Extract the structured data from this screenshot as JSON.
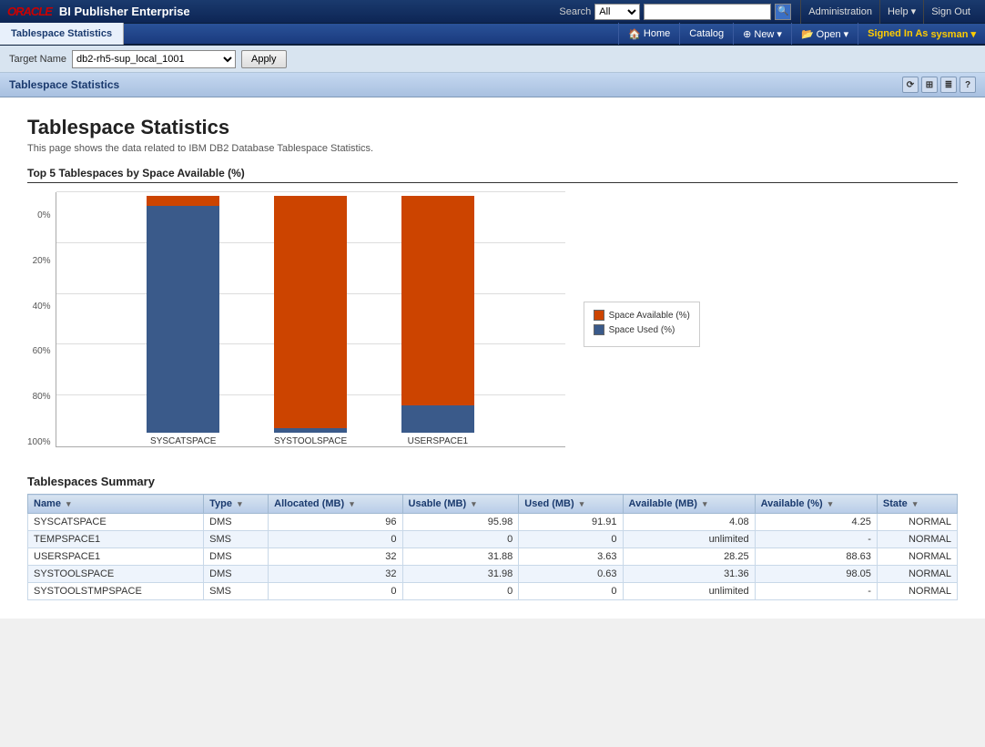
{
  "topNav": {
    "oracleLogo": "ORACLE",
    "appTitle": "BI Publisher Enterprise",
    "searchLabel": "Search",
    "searchScope": "All",
    "searchPlaceholder": "",
    "links": [
      {
        "label": "Administration",
        "name": "admin-link"
      },
      {
        "label": "Help ▾",
        "name": "help-link"
      },
      {
        "label": "Sign Out",
        "name": "signout-link"
      }
    ]
  },
  "secondNav": {
    "pageTab": "Tablespace Statistics",
    "navItems": [
      {
        "label": "Home",
        "name": "home-nav"
      },
      {
        "label": "Catalog",
        "name": "catalog-nav"
      },
      {
        "label": "⊕ New ▾",
        "name": "new-nav"
      },
      {
        "label": "📂 Open ▾",
        "name": "open-nav"
      },
      {
        "label": "Signed In As",
        "name": "signedin-label"
      },
      {
        "label": "sysman ▾",
        "name": "user-nav"
      }
    ]
  },
  "targetBar": {
    "label": "Target Name",
    "selectValue": "db2-rh5-sup_local_1001",
    "applyLabel": "Apply"
  },
  "contentHeader": {
    "title": "Tablespace Statistics",
    "icons": [
      "⟳",
      "⊞",
      "≣",
      "?"
    ]
  },
  "report": {
    "title": "Tablespace Statistics",
    "subtitle": "This page shows the data related to IBM DB2 Database Tablespace Statistics.",
    "chartSectionTitle": "Top 5 Tablespaces by Space Available (%)",
    "tableSectionTitle": "Tablespaces Summary"
  },
  "chart": {
    "yLabels": [
      "0%",
      "20%",
      "40%",
      "60%",
      "80%",
      "100%"
    ],
    "bars": [
      {
        "name": "SYSCATSPACE",
        "availPct": 4.25,
        "usedPct": 95.75,
        "availHeight": 13,
        "usedHeight": 247
      },
      {
        "name": "SYSTOOLSPACE",
        "availPct": 98.05,
        "usedPct": 1.95,
        "availHeight": 253,
        "usedHeight": 7
      },
      {
        "name": "USERSPACE1",
        "availPct": 88.63,
        "usedPct": 11.37,
        "availHeight": 229,
        "usedHeight": 31
      }
    ],
    "legend": [
      {
        "label": "Space Available (%)",
        "color": "#cc4400",
        "name": "legend-available"
      },
      {
        "label": "Space Used (%)",
        "color": "#3a5a8a",
        "name": "legend-used"
      }
    ]
  },
  "table": {
    "columns": [
      {
        "label": "Name",
        "name": "col-name"
      },
      {
        "label": "Type",
        "name": "col-type"
      },
      {
        "label": "Allocated (MB)",
        "name": "col-allocated"
      },
      {
        "label": "Usable (MB)",
        "name": "col-usable"
      },
      {
        "label": "Used (MB)",
        "name": "col-used"
      },
      {
        "label": "Available (MB)",
        "name": "col-available-mb"
      },
      {
        "label": "Available (%)",
        "name": "col-available-pct"
      },
      {
        "label": "State",
        "name": "col-state"
      }
    ],
    "rows": [
      {
        "name": "SYSCATSPACE",
        "type": "DMS",
        "allocated": "96",
        "usable": "95.98",
        "used": "91.91",
        "availMB": "4.08",
        "availPct": "4.25",
        "state": "NORMAL"
      },
      {
        "name": "TEMPSPACE1",
        "type": "SMS",
        "allocated": "0",
        "usable": "0",
        "used": "0",
        "availMB": "unlimited",
        "availPct": "-",
        "state": "NORMAL"
      },
      {
        "name": "USERSPACE1",
        "type": "DMS",
        "allocated": "32",
        "usable": "31.88",
        "used": "3.63",
        "availMB": "28.25",
        "availPct": "88.63",
        "state": "NORMAL"
      },
      {
        "name": "SYSTOOLSPACE",
        "type": "DMS",
        "allocated": "32",
        "usable": "31.98",
        "used": "0.63",
        "availMB": "31.36",
        "availPct": "98.05",
        "state": "NORMAL"
      },
      {
        "name": "SYSTOOLSTMPSPACE",
        "type": "SMS",
        "allocated": "0",
        "usable": "0",
        "used": "0",
        "availMB": "unlimited",
        "availPct": "-",
        "state": "NORMAL"
      }
    ]
  }
}
